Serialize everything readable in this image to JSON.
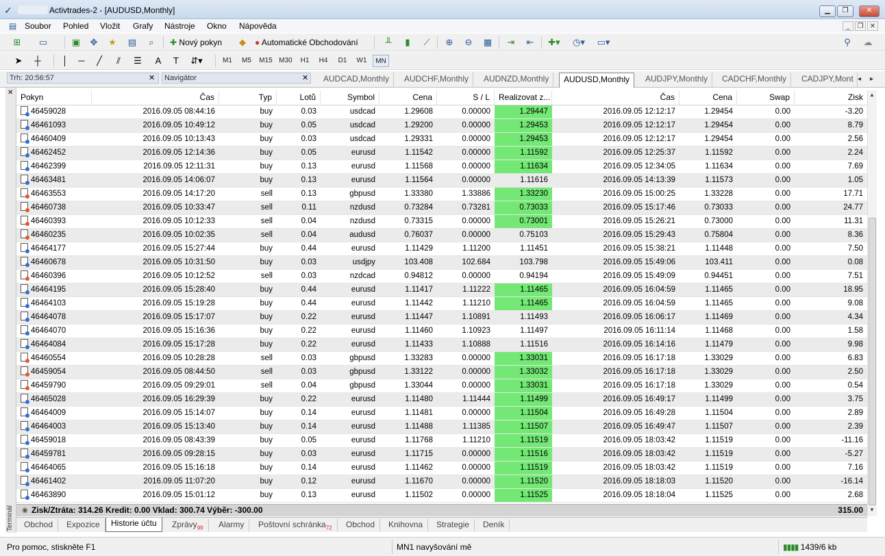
{
  "window": {
    "title": "Activtrades-2 - [AUDUSD,Monthly]"
  },
  "menu": [
    "Soubor",
    "Pohled",
    "Vložit",
    "Grafy",
    "Nástroje",
    "Okno",
    "Nápověda"
  ],
  "toolbar": {
    "new_order": "Nový pokyn",
    "auto_trading": "Automatické Obchodování"
  },
  "timeframes": [
    "M1",
    "M5",
    "M15",
    "M30",
    "H1",
    "H4",
    "D1",
    "W1",
    "MN"
  ],
  "panels": {
    "market_watch": "Trh: 20:56:57",
    "navigator": "Navigátor"
  },
  "chart_tabs": [
    "AUDCAD,Monthly",
    "AUDCHF,Monthly",
    "AUDNZD,Monthly",
    "AUDUSD,Monthly",
    "AUDJPY,Monthly",
    "CADCHF,Monthly",
    "CADJPY,Mont"
  ],
  "columns": [
    "Pokyn",
    "Čas",
    "Typ",
    "Lotů",
    "Symbol",
    "Cena",
    "S / L",
    "Realizovat z...",
    "Čas",
    "Cena",
    "Swap",
    "Zisk"
  ],
  "rows": [
    [
      "46459028",
      "2016.09.05 08:44:16",
      "buy",
      "0.03",
      "usdcad",
      "1.29608",
      "0.00000",
      "1.29447",
      "2016.09.05 12:12:17",
      "1.29454",
      "0.00",
      "-3.20",
      true
    ],
    [
      "46461093",
      "2016.09.05 10:49:12",
      "buy",
      "0.05",
      "usdcad",
      "1.29200",
      "0.00000",
      "1.29453",
      "2016.09.05 12:12:17",
      "1.29454",
      "0.00",
      "8.79",
      true
    ],
    [
      "46460409",
      "2016.09.05 10:13:43",
      "buy",
      "0.03",
      "usdcad",
      "1.29331",
      "0.00000",
      "1.29453",
      "2016.09.05 12:12:17",
      "1.29454",
      "0.00",
      "2.56",
      true
    ],
    [
      "46462452",
      "2016.09.05 12:14:36",
      "buy",
      "0.05",
      "eurusd",
      "1.11542",
      "0.00000",
      "1.11592",
      "2016.09.05 12:25:37",
      "1.11592",
      "0.00",
      "2.24",
      true
    ],
    [
      "46462399",
      "2016.09.05 12:11:31",
      "buy",
      "0.13",
      "eurusd",
      "1.11568",
      "0.00000",
      "1.11634",
      "2016.09.05 12:34:05",
      "1.11634",
      "0.00",
      "7.69",
      true
    ],
    [
      "46463481",
      "2016.09.05 14:06:07",
      "buy",
      "0.13",
      "eurusd",
      "1.11564",
      "0.00000",
      "1.11616",
      "2016.09.05 14:13:39",
      "1.11573",
      "0.00",
      "1.05",
      false
    ],
    [
      "46463553",
      "2016.09.05 14:17:20",
      "sell",
      "0.13",
      "gbpusd",
      "1.33380",
      "1.33886",
      "1.33230",
      "2016.09.05 15:00:25",
      "1.33228",
      "0.00",
      "17.71",
      true
    ],
    [
      "46460738",
      "2016.09.05 10:33:47",
      "sell",
      "0.11",
      "nzdusd",
      "0.73284",
      "0.73281",
      "0.73033",
      "2016.09.05 15:17:46",
      "0.73033",
      "0.00",
      "24.77",
      true
    ],
    [
      "46460393",
      "2016.09.05 10:12:33",
      "sell",
      "0.04",
      "nzdusd",
      "0.73315",
      "0.00000",
      "0.73001",
      "2016.09.05 15:26:21",
      "0.73000",
      "0.00",
      "11.31",
      true
    ],
    [
      "46460235",
      "2016.09.05 10:02:35",
      "sell",
      "0.04",
      "audusd",
      "0.76037",
      "0.00000",
      "0.75103",
      "2016.09.05 15:29:43",
      "0.75804",
      "0.00",
      "8.36",
      false
    ],
    [
      "46464177",
      "2016.09.05 15:27:44",
      "buy",
      "0.44",
      "eurusd",
      "1.11429",
      "1.11200",
      "1.11451",
      "2016.09.05 15:38:21",
      "1.11448",
      "0.00",
      "7.50",
      false
    ],
    [
      "46460678",
      "2016.09.05 10:31:50",
      "buy",
      "0.03",
      "usdjpy",
      "103.408",
      "102.684",
      "103.798",
      "2016.09.05 15:49:06",
      "103.411",
      "0.00",
      "0.08",
      false
    ],
    [
      "46460396",
      "2016.09.05 10:12:52",
      "sell",
      "0.03",
      "nzdcad",
      "0.94812",
      "0.00000",
      "0.94194",
      "2016.09.05 15:49:09",
      "0.94451",
      "0.00",
      "7.51",
      false
    ],
    [
      "46464195",
      "2016.09.05 15:28:40",
      "buy",
      "0.44",
      "eurusd",
      "1.11417",
      "1.11222",
      "1.11465",
      "2016.09.05 16:04:59",
      "1.11465",
      "0.00",
      "18.95",
      true
    ],
    [
      "46464103",
      "2016.09.05 15:19:28",
      "buy",
      "0.44",
      "eurusd",
      "1.11442",
      "1.11210",
      "1.11465",
      "2016.09.05 16:04:59",
      "1.11465",
      "0.00",
      "9.08",
      true
    ],
    [
      "46464078",
      "2016.09.05 15:17:07",
      "buy",
      "0.22",
      "eurusd",
      "1.11447",
      "1.10891",
      "1.11493",
      "2016.09.05 16:06:17",
      "1.11469",
      "0.00",
      "4.34",
      false
    ],
    [
      "46464070",
      "2016.09.05 15:16:36",
      "buy",
      "0.22",
      "eurusd",
      "1.11460",
      "1.10923",
      "1.11497",
      "2016.09.05 16:11:14",
      "1.11468",
      "0.00",
      "1.58",
      false
    ],
    [
      "46464084",
      "2016.09.05 15:17:28",
      "buy",
      "0.22",
      "eurusd",
      "1.11433",
      "1.10888",
      "1.11516",
      "2016.09.05 16:14:16",
      "1.11479",
      "0.00",
      "9.98",
      false
    ],
    [
      "46460554",
      "2016.09.05 10:28:28",
      "sell",
      "0.03",
      "gbpusd",
      "1.33283",
      "0.00000",
      "1.33031",
      "2016.09.05 16:17:18",
      "1.33029",
      "0.00",
      "6.83",
      true
    ],
    [
      "46459054",
      "2016.09.05 08:44:50",
      "sell",
      "0.03",
      "gbpusd",
      "1.33122",
      "0.00000",
      "1.33032",
      "2016.09.05 16:17:18",
      "1.33029",
      "0.00",
      "2.50",
      true
    ],
    [
      "46459790",
      "2016.09.05 09:29:01",
      "sell",
      "0.04",
      "gbpusd",
      "1.33044",
      "0.00000",
      "1.33031",
      "2016.09.05 16:17:18",
      "1.33029",
      "0.00",
      "0.54",
      true
    ],
    [
      "46465028",
      "2016.09.05 16:29:39",
      "buy",
      "0.22",
      "eurusd",
      "1.11480",
      "1.11444",
      "1.11499",
      "2016.09.05 16:49:17",
      "1.11499",
      "0.00",
      "3.75",
      true
    ],
    [
      "46464009",
      "2016.09.05 15:14:07",
      "buy",
      "0.14",
      "eurusd",
      "1.11481",
      "0.00000",
      "1.11504",
      "2016.09.05 16:49:28",
      "1.11504",
      "0.00",
      "2.89",
      true
    ],
    [
      "46464003",
      "2016.09.05 15:13:40",
      "buy",
      "0.14",
      "eurusd",
      "1.11488",
      "1.11385",
      "1.11507",
      "2016.09.05 16:49:47",
      "1.11507",
      "0.00",
      "2.39",
      true
    ],
    [
      "46459018",
      "2016.09.05 08:43:39",
      "buy",
      "0.05",
      "eurusd",
      "1.11768",
      "1.11210",
      "1.11519",
      "2016.09.05 18:03:42",
      "1.11519",
      "0.00",
      "-11.16",
      true
    ],
    [
      "46459781",
      "2016.09.05 09:28:15",
      "buy",
      "0.03",
      "eurusd",
      "1.11715",
      "0.00000",
      "1.11516",
      "2016.09.05 18:03:42",
      "1.11519",
      "0.00",
      "-5.27",
      true
    ],
    [
      "46464065",
      "2016.09.05 15:16:18",
      "buy",
      "0.14",
      "eurusd",
      "1.11462",
      "0.00000",
      "1.11519",
      "2016.09.05 18:03:42",
      "1.11519",
      "0.00",
      "7.16",
      true
    ],
    [
      "46461402",
      "2016.09.05 11:07:20",
      "buy",
      "0.12",
      "eurusd",
      "1.11670",
      "0.00000",
      "1.11520",
      "2016.09.05 18:18:03",
      "1.11520",
      "0.00",
      "-16.14",
      true
    ],
    [
      "46463890",
      "2016.09.05 15:01:12",
      "buy",
      "0.13",
      "eurusd",
      "1.11502",
      "0.00000",
      "1.11525",
      "2016.09.05 18:18:04",
      "1.11525",
      "0.00",
      "2.68",
      true
    ]
  ],
  "summary": {
    "text": "Zisk/Ztráta: 314.26  Kredit: 0.00  Vklad: 300.74  Výběr: -300.00",
    "total": "315.00"
  },
  "terminal_label": "Terminál",
  "bottom_tabs": [
    {
      "label": "Obchod",
      "badge": ""
    },
    {
      "label": "Expozice",
      "badge": ""
    },
    {
      "label": "Historie účtu",
      "badge": ""
    },
    {
      "label": "Zprávy",
      "badge": "99"
    },
    {
      "label": "Alarmy",
      "badge": ""
    },
    {
      "label": "Poštovní schránka",
      "badge": "72"
    },
    {
      "label": "Obchod",
      "badge": ""
    },
    {
      "label": "Knihovna",
      "badge": ""
    },
    {
      "label": "Strategie",
      "badge": ""
    },
    {
      "label": "Deník",
      "badge": ""
    }
  ],
  "status": {
    "help": "Pro pomoc, stiskněte F1",
    "timeframe": "MN1 navyšování mě",
    "traffic": "1439/6 kb"
  },
  "colors": {
    "highlight": "#73e874",
    "alt_row": "#ebebeb"
  }
}
